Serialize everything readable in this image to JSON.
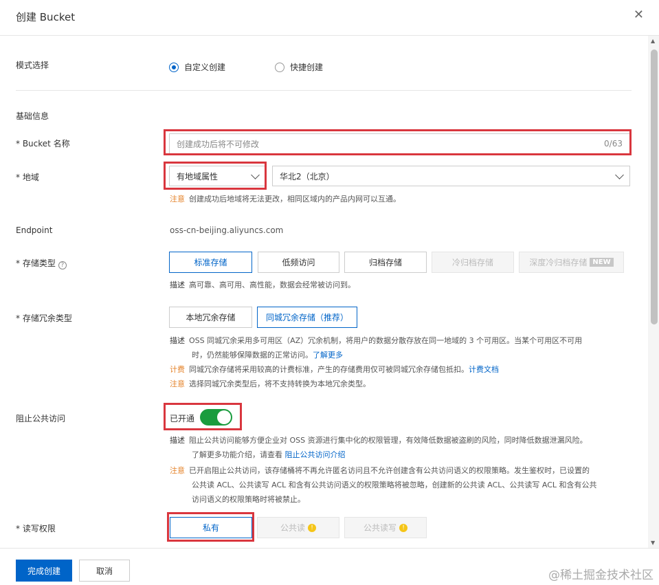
{
  "dialog": {
    "title": "创建 Bucket",
    "close_icon": "✕"
  },
  "mode": {
    "label": "模式选择",
    "options": [
      "自定义创建",
      "快捷创建"
    ],
    "selected": "自定义创建"
  },
  "basic": {
    "section_title": "基础信息",
    "bucket_name": {
      "label": "* Bucket 名称",
      "placeholder": "创建成功后将不可修改",
      "count": "0/63"
    },
    "region": {
      "label": "* 地域",
      "type_value": "有地域属性",
      "region_value": "华北2（北京）",
      "note_tag": "注意",
      "note": "创建成功后地域将无法更改，相同区域内的产品内网可以互通。"
    },
    "endpoint": {
      "label": "Endpoint",
      "value": "oss-cn-beijing.aliyuncs.com"
    },
    "storage_class": {
      "label": "* 存储类型",
      "help_icon": "?",
      "options": [
        "标准存储",
        "低频访问",
        "归档存储",
        "冷归档存储",
        "深度冷归档存储"
      ],
      "new_badge": "NEW",
      "desc_tag": "描述",
      "desc": "高可靠、高可用、高性能，数据会经常被访问到。"
    },
    "redundancy": {
      "label": "* 存储冗余类型",
      "options": [
        "本地冗余存储",
        "同城冗余存储（推荐）"
      ],
      "desc_tag": "描述",
      "desc_line1": "OSS 同城冗余采用多可用区（AZ）冗余机制，将用户的数据分散存放在同一地域的 3 个可用区。当某个可用区不可用",
      "desc_line2": "时，仍然能够保障数据的正常访问。",
      "desc_link": "了解更多",
      "billing_tag": "计费",
      "billing": "同城冗余存储将采用较高的计费标准，产生的存储费用仅可被同城冗余存储包抵扣。",
      "billing_link": "计费文档",
      "note_tag": "注意",
      "note": "选择同城冗余类型后，将不支持转换为本地冗余类型。"
    },
    "block_public": {
      "label": "阻止公共访问",
      "status": "已开通",
      "desc_tag": "描述",
      "desc_line1": "阻止公共访问能够方便企业对 OSS 资源进行集中化的权限管理，有效降低数据被盗刷的风险，同时降低数据泄漏风险。",
      "desc_line2": "了解更多功能介绍，请查看",
      "desc_link": "阻止公共访问介绍",
      "note_tag": "注意",
      "note_line1": "已开启阻止公共访问，该存储桶将不再允许匿名访问且不允许创建含有公共访问语义的权限策略。发生鉴权时，已设置的",
      "note_line2": "公共读 ACL、公共读写 ACL 和含有公共访问语义的权限策略将被忽略，创建新的公共读 ACL、公共读写 ACL 和含有公共",
      "note_line3": "访问语义的权限策略时将被禁止。"
    },
    "acl": {
      "label": "* 读写权限",
      "options": [
        "私有",
        "公共读",
        "公共读写"
      ],
      "warn_icon": "!"
    }
  },
  "footer": {
    "confirm": "完成创建",
    "cancel": "取消",
    "watermark": "@稀土掘金技术社区"
  }
}
